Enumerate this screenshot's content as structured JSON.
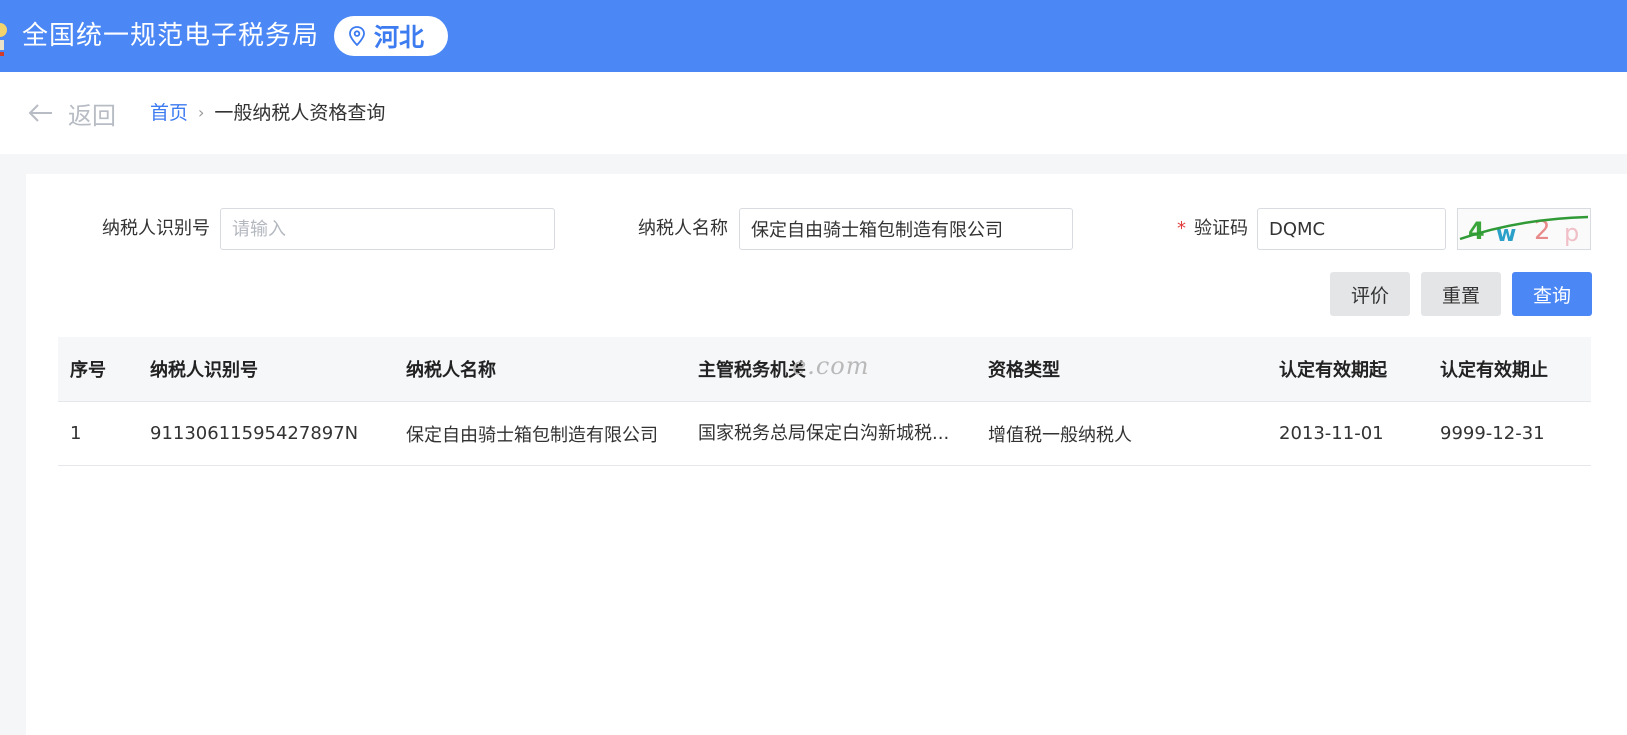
{
  "header": {
    "site_title": "全国统一规范电子税务局",
    "region": "河北",
    "brand_color": "#4b87f5"
  },
  "nav": {
    "back_label": "返回",
    "breadcrumb_home": "首页",
    "breadcrumb_separator": "›",
    "breadcrumb_current": "一般纳税人资格查询"
  },
  "form": {
    "taxpayer_id_label": "纳税人识别号",
    "taxpayer_id_placeholder": "请输入",
    "taxpayer_id_value": "",
    "taxpayer_name_label": "纳税人名称",
    "taxpayer_name_value": "保定自由骑士箱包制造有限公司",
    "captcha_required_mark": "*",
    "captcha_label": "验证码",
    "captcha_value": "DQMC",
    "captcha_image_text": "4w2p"
  },
  "buttons": {
    "evaluate": "评价",
    "reset": "重置",
    "query": "查询"
  },
  "table": {
    "columns": [
      "序号",
      "纳税人识别号",
      "纳税人名称",
      "主管税务机关",
      "资格类型",
      "认定有效期起",
      "认定有效期止"
    ],
    "rows": [
      [
        "1",
        "91130611595427897N",
        "保定自由骑士箱包制造有限公司",
        "国家税务总局保定白沟新城税...",
        "增值税一般纳税人",
        "2013-11-01",
        "9999-12-31"
      ]
    ]
  },
  "watermark": "e.com"
}
